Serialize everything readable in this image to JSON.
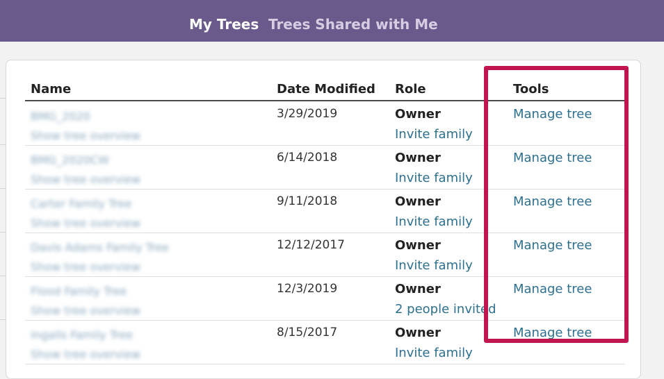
{
  "tabs": {
    "my_trees": "My Trees",
    "shared_with_me": "Trees Shared with Me"
  },
  "table": {
    "headers": {
      "name": "Name",
      "date_modified": "Date Modified",
      "role": "Role",
      "tools": "Tools"
    },
    "rows": [
      {
        "name": "BMG_2020",
        "sub": "Show tree overview",
        "date": "3/29/2019",
        "role": "Owner",
        "invite": "Invite family",
        "tool": "Manage tree"
      },
      {
        "name": "BMG_2020CW",
        "sub": "Show tree overview",
        "date": "6/14/2018",
        "role": "Owner",
        "invite": "Invite family",
        "tool": "Manage tree"
      },
      {
        "name": "Carter Family Tree",
        "sub": "Show tree overview",
        "date": "9/11/2018",
        "role": "Owner",
        "invite": "Invite family",
        "tool": "Manage tree"
      },
      {
        "name": "Davis Adams Family Tree",
        "sub": "Show tree overview",
        "date": "12/12/2017",
        "role": "Owner",
        "invite": "Invite family",
        "tool": "Manage tree"
      },
      {
        "name": "Flood Family Tree",
        "sub": "Show tree overview",
        "date": "12/3/2019",
        "role": "Owner",
        "invite": "2 people invited",
        "tool": "Manage tree"
      },
      {
        "name": "Ingalls Family Tree",
        "sub": "Show tree overview",
        "date": "8/15/2017",
        "role": "Owner",
        "invite": "Invite family",
        "tool": "Manage tree"
      }
    ]
  },
  "colors": {
    "topbar": "#6a5a8c",
    "link": "#2d6f8f",
    "highlight": "#c0154f"
  }
}
